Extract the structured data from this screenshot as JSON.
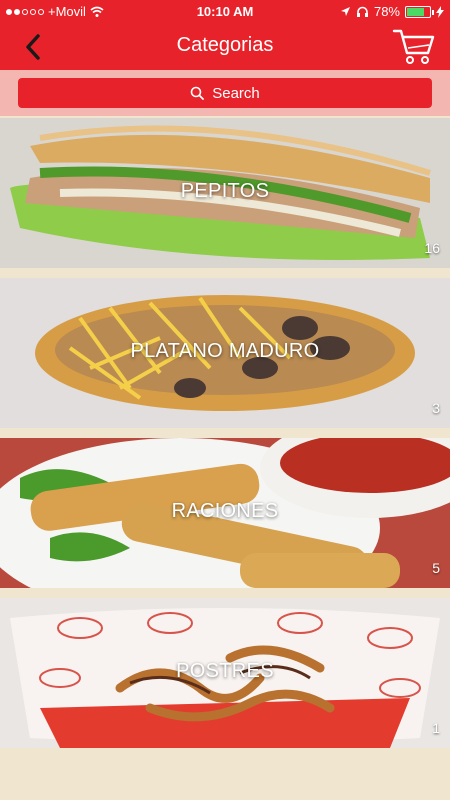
{
  "status_bar": {
    "carrier": "+Movil",
    "time": "10:10 AM",
    "battery": "78%",
    "battery_level": 0.78
  },
  "nav": {
    "title": "Categorias"
  },
  "search": {
    "label": "Search"
  },
  "categories": [
    {
      "name": "PEPITOS",
      "count": "16"
    },
    {
      "name": "PLATANO MADURO",
      "count": "3"
    },
    {
      "name": "RACIONES",
      "count": "5"
    },
    {
      "name": "POSTRES",
      "count": "1"
    }
  ],
  "colors": {
    "brand_red": "#e8222a",
    "search_strip": "#f3b6b0",
    "background": "#f0e6cf"
  },
  "icons": {
    "back": "chevron-left-icon",
    "cart": "shopping-cart-icon",
    "search": "search-icon"
  }
}
